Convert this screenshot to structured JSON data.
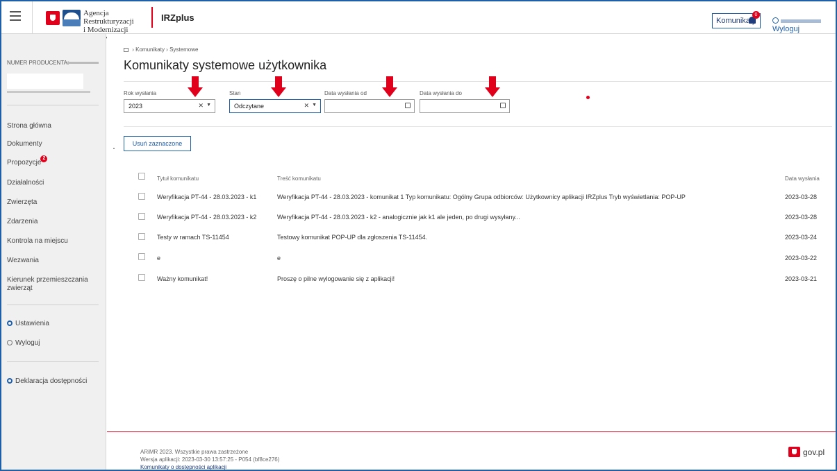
{
  "header": {
    "agency_line1": "Agencja Restrukturyzacji",
    "agency_line2": "i Modernizacji Rolnictwa",
    "app_name": "IRZplus",
    "notifications_label": "Komunikaty",
    "notifications_count": "0",
    "logout_label": "Wyloguj"
  },
  "sidebar": {
    "producer_label": "NUMER PRODUCENTA:",
    "nav": [
      {
        "label": "Strona główna"
      },
      {
        "label": "Dokumenty"
      },
      {
        "label": "Propozycje",
        "badge": "2"
      },
      {
        "label": "Działalności"
      },
      {
        "label": "Zwierzęta"
      },
      {
        "label": "Zdarzenia"
      },
      {
        "label": "Kontrola na miejscu"
      },
      {
        "label": "Wezwania"
      },
      {
        "label": "Kierunek przemieszczania zwierząt"
      }
    ],
    "settings_label": "Ustawienia",
    "logout_label": "Wyloguj",
    "accessibility_label": "Deklaracja dostępności"
  },
  "breadcrumb": {
    "items": [
      "Komunikaty",
      "Systemowe"
    ]
  },
  "page": {
    "title": "Komunikaty systemowe użytkownika"
  },
  "filters": {
    "year_label": "Rok wysłania",
    "year_value": "2023",
    "status_label": "Stan",
    "status_value": "Odczytane",
    "date_from_label": "Data wysłania od",
    "date_from_value": "",
    "date_to_label": "Data wysłania do",
    "date_to_value": ""
  },
  "actions": {
    "delete_selected": "Usuń zaznaczone"
  },
  "table": {
    "headers": {
      "title": "Tytuł komunikatu",
      "content": "Treść komunikatu",
      "date": "Data wysłania"
    },
    "rows": [
      {
        "title": "Weryfikacja PT-44 - 28.03.2023 - k1",
        "content": "Weryfikacja PT-44 - 28.03.2023 - komunikat 1 Typ komunikatu: Ogólny Grupa odbiorców: Użytkownicy aplikacji IRZplus Tryb wyświetlania: POP-UP",
        "date": "2023-03-28"
      },
      {
        "title": "Weryfikacja PT-44 - 28.03.2023 - k2",
        "content": "Weryfikacja PT-44 - 28.03.2023 - k2 - analogicznie jak k1 ale jeden, po drugi wysyłany...",
        "date": "2023-03-28"
      },
      {
        "title": "Testy w ramach TS-11454",
        "content": "Testowy komunikat POP-UP dla zgłoszenia TS-11454.",
        "date": "2023-03-24"
      },
      {
        "title": "e",
        "content": "e",
        "date": "2023-03-22"
      },
      {
        "title": "Ważny komunikat!",
        "content": "Proszę o pilne wylogowanie się z aplikacji!",
        "date": "2023-03-21"
      }
    ]
  },
  "footer": {
    "copyright": "ARiMR 2023. Wszystkie prawa zastrzeżone",
    "version": "Wersja aplikacji: 2023-03-30 13:57:25 - P054 (bf8ce276)",
    "accessibility_link": "Komunikaty o dostępności aplikacji",
    "gov": "gov.pl"
  }
}
